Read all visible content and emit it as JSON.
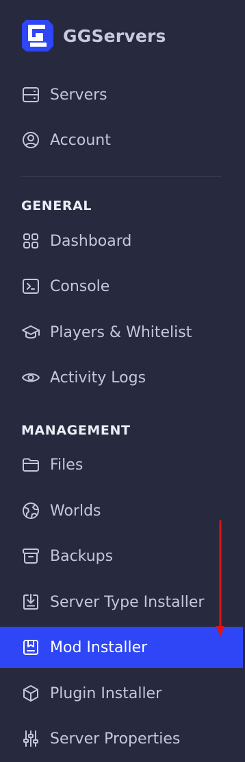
{
  "brand": {
    "name": "GGServers",
    "logo_icon": "ggservers-logo-icon",
    "accent_color": "#2e46f5"
  },
  "top_nav": [
    {
      "label": "Servers",
      "icon": "server-icon"
    },
    {
      "label": "Account",
      "icon": "user-circle-icon"
    }
  ],
  "sections": [
    {
      "title": "GENERAL",
      "items": [
        {
          "label": "Dashboard",
          "icon": "grid-icon"
        },
        {
          "label": "Console",
          "icon": "terminal-icon"
        },
        {
          "label": "Players & Whitelist",
          "icon": "graduation-cap-icon"
        },
        {
          "label": "Activity Logs",
          "icon": "eye-icon"
        }
      ]
    },
    {
      "title": "MANAGEMENT",
      "items": [
        {
          "label": "Files",
          "icon": "folder-icon"
        },
        {
          "label": "Worlds",
          "icon": "globe-icon"
        },
        {
          "label": "Backups",
          "icon": "archive-icon"
        },
        {
          "label": "Server Type Installer",
          "icon": "download-box-icon"
        },
        {
          "label": "Mod Installer",
          "icon": "book-bookmark-icon",
          "active": true
        },
        {
          "label": "Plugin Installer",
          "icon": "cube-icon"
        },
        {
          "label": "Server Properties",
          "icon": "sliders-icon"
        }
      ]
    }
  ],
  "annotation": {
    "arrow_color": "#e01414"
  }
}
